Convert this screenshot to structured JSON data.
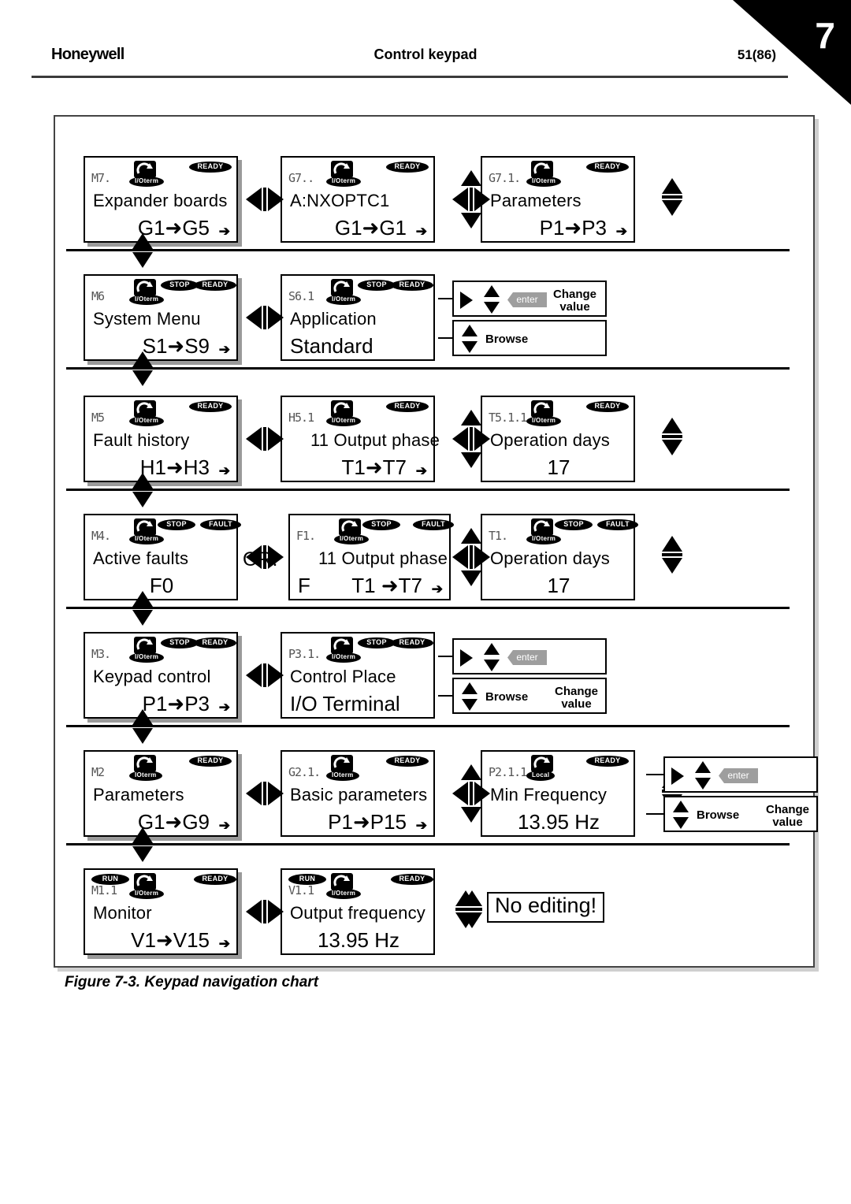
{
  "header": {
    "brand": "Honeywell",
    "title": "Control keypad",
    "page": "51(86)",
    "chapter": "7"
  },
  "figure": {
    "caption": "Figure 7-3. Keypad navigation chart"
  },
  "labels": {
    "or": "OR:",
    "no_editing": "No editing!",
    "enter": "enter",
    "browse": "Browse",
    "change_value_line1": "Change",
    "change_value_line2": "value"
  },
  "icons": {
    "rotate": "rotation-direction-icon",
    "io_term": "I/Oterm",
    "o_term": "IOterm",
    "local": "Local",
    "ready": "READY",
    "stop": "STOP",
    "run": "RUN",
    "fault": "FAULT"
  },
  "rows": [
    {
      "id": "expander-boards",
      "panels": [
        {
          "code": "M7.",
          "line1": "Expander boards",
          "line2": "G1➜G5",
          "badges": [
            "READY"
          ],
          "term": "I/Oterm",
          "stack": false,
          "shadow": true,
          "more": true
        },
        {
          "code": "G7..",
          "line1": "A:NXOPTC1",
          "line2": "G1➜G1",
          "badges": [
            "READY"
          ],
          "term": "I/Oterm",
          "stack": true,
          "shadow": false,
          "more": true
        },
        {
          "code": "G7.1.",
          "line1": "Parameters",
          "line2": "P1➜P3",
          "badges": [
            "READY"
          ],
          "term": "I/Oterm",
          "stack": true,
          "shadow": false,
          "more": true
        }
      ]
    },
    {
      "id": "system-menu",
      "panels": [
        {
          "code": "M6",
          "line1": "System Menu",
          "line2": "S1➜S9",
          "badges": [
            "STOP",
            "READY"
          ],
          "term": "I/Oterm",
          "stack": false,
          "shadow": true,
          "more": true
        },
        {
          "code": "S6.1",
          "line1": "Application",
          "line2": "Standard",
          "badges": [
            "STOP",
            "READY"
          ],
          "term": "I/Oterm",
          "stack": true,
          "shadow": false,
          "more": false
        }
      ],
      "callout": "change-browse"
    },
    {
      "id": "fault-history",
      "panels": [
        {
          "code": "M5",
          "line1": "Fault history",
          "line2": "H1➜H3",
          "badges": [
            "READY"
          ],
          "term": "I/Oterm",
          "stack": false,
          "shadow": true,
          "more": true
        },
        {
          "code": "H5.1",
          "line1": "11 Output phase",
          "line2": "T1➜T7",
          "badges": [
            "READY"
          ],
          "term": "I/Oterm",
          "stack": true,
          "shadow": false,
          "more": true
        },
        {
          "code": "T5.1.1",
          "line1": "Operation days",
          "line2": "17",
          "badges": [
            "READY"
          ],
          "term": "I/Oterm",
          "stack": true,
          "shadow": false,
          "more": false
        }
      ]
    },
    {
      "id": "active-faults",
      "panels": [
        {
          "code": "M4.",
          "line1": "Active faults",
          "line2": "F0",
          "badges": [
            "STOP",
            "FAULT"
          ],
          "term": "I/Oterm",
          "stack": false,
          "shadow": false,
          "more": false
        },
        {
          "code": "F1.",
          "line1": "11 Output phase",
          "line2": "T1 ➜T7",
          "prefix": "F",
          "badges": [
            "STOP",
            "FAULT"
          ],
          "term": "I/Oterm",
          "stack": true,
          "shadow": false,
          "more": true
        },
        {
          "code": "T1.",
          "line1": "Operation days",
          "line2": "17",
          "badges": [
            "STOP",
            "FAULT"
          ],
          "term": "I/Oterm",
          "stack": true,
          "shadow": false,
          "more": false
        }
      ]
    },
    {
      "id": "keypad-control",
      "panels": [
        {
          "code": "M3.",
          "line1": "Keypad control",
          "line2": "P1➜P3",
          "badges": [
            "STOP",
            "READY"
          ],
          "term": "I/Oterm",
          "stack": false,
          "shadow": true,
          "more": true
        },
        {
          "code": "P3.1.",
          "line1": "Control Place",
          "line2": "I/O Terminal",
          "badges": [
            "STOP",
            "READY"
          ],
          "term": "I/Oterm",
          "stack": true,
          "shadow": false,
          "more": false
        }
      ],
      "callout": "browse-change"
    },
    {
      "id": "parameters",
      "panels": [
        {
          "code": "M2",
          "line1": "Parameters",
          "line2": "G1➜G9",
          "badges": [
            "READY"
          ],
          "term": "IOterm",
          "stack": false,
          "shadow": true,
          "more": true
        },
        {
          "code": "G2.1.",
          "line1": "Basic parameters",
          "line2": "P1➜P15",
          "badges": [
            "READY"
          ],
          "term": "IOterm",
          "stack": true,
          "shadow": false,
          "more": true
        },
        {
          "code": "P2.1.1",
          "line1": "Min Frequency",
          "line2": "13.95 Hz",
          "badges": [
            "READY"
          ],
          "term": "Local",
          "stack": true,
          "shadow": false,
          "more": false
        }
      ],
      "callout": "browse-change"
    },
    {
      "id": "monitor",
      "panels": [
        {
          "code": "M1.1",
          "line1": "Monitor",
          "line2": "V1➜V15",
          "badges": [
            "RUN",
            "READY"
          ],
          "term": "I/Oterm",
          "stack": false,
          "shadow": true,
          "more": true
        },
        {
          "code": "V1.1",
          "line1": "Output frequency",
          "line2": "13.95 Hz",
          "badges": [
            "RUN",
            "READY"
          ],
          "term": "I/Oterm",
          "stack": true,
          "shadow": false,
          "more": false
        }
      ],
      "note": "No editing!"
    }
  ]
}
